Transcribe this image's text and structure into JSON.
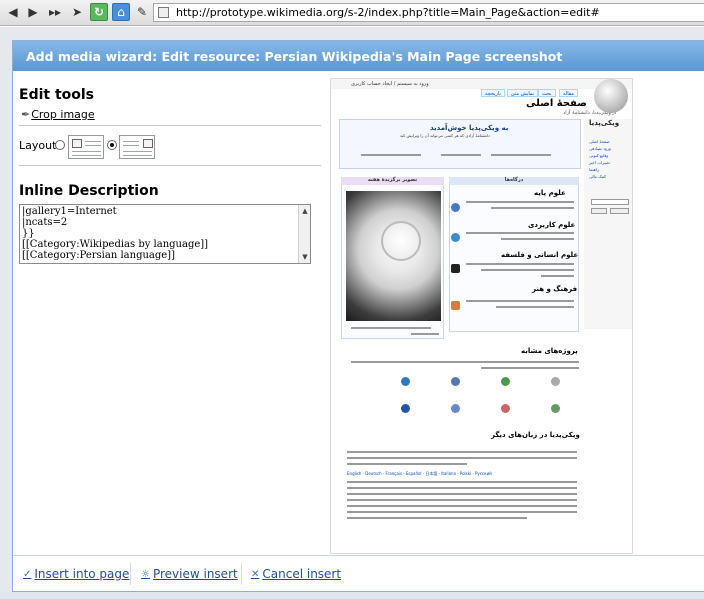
{
  "browser": {
    "url": "http://prototype.wikimedia.org/s-2/index.php?title=Main_Page&action=edit#",
    "buttons": {
      "back": "◀",
      "forward": "▶",
      "fast_forward": "▸▸",
      "refresh": "↻",
      "home": "⌂",
      "edit": "✎"
    }
  },
  "dialog": {
    "title": "Add media wizard: Edit resource: Persian Wikipedia's Main Page screenshot",
    "edit_tools": {
      "heading": "Edit tools",
      "crop_label": "Crop image",
      "layout_label": "Layout:",
      "layout_selected": "right"
    },
    "inline_description": {
      "heading": "Inline Description",
      "lines": [
        "|gallery1=Internet",
        "|ncats=2",
        "}}",
        "[[Category:Wikipedias by language]]",
        "[[Category:Persian language]]"
      ]
    },
    "preview": {
      "top_text": "ورود به سیستم / ایجاد حساب کاربری",
      "tabs": [
        "مقاله",
        "بحث",
        "نمایش متن",
        "تاریخچه"
      ],
      "page_title": "صفحهٔ اصلی",
      "subtitle": "از ویکی‌پدیا، دانشنامهٔ آزاد",
      "logo_text": "ویکی‌پدیا",
      "nav_items": [
        "صفحهٔ اصلی",
        "ورود تصادفی",
        "وقایع کنونی",
        "تغییرات اخیر",
        "راهنما",
        "کمک مالی"
      ],
      "welcome_title": "به ویکی‌پدیا خوش‌آمدید",
      "welcome_sub": "دانشنامهٔ آزادی که هر کسی می‌تواند آن را ویرایش کند",
      "section_left": "تصویر برگزیدهٔ هفته",
      "section_right": "درگاه‌ها",
      "headings": [
        "علوم پایه",
        "علوم کاربردی",
        "علوم انسانی و فلسفه",
        "فرهنگ و هنر",
        "پروژه‌های مشابه",
        "ویکی‌پدیا در زبان‌های دیگر"
      ],
      "langs_line": "English · Deutsch · Français · Español · 日本語 · Italiano · Polski · Русский"
    },
    "footer": {
      "insert_label": "Insert into page",
      "preview_label": "Preview insert",
      "cancel_label": "Cancel insert"
    }
  }
}
